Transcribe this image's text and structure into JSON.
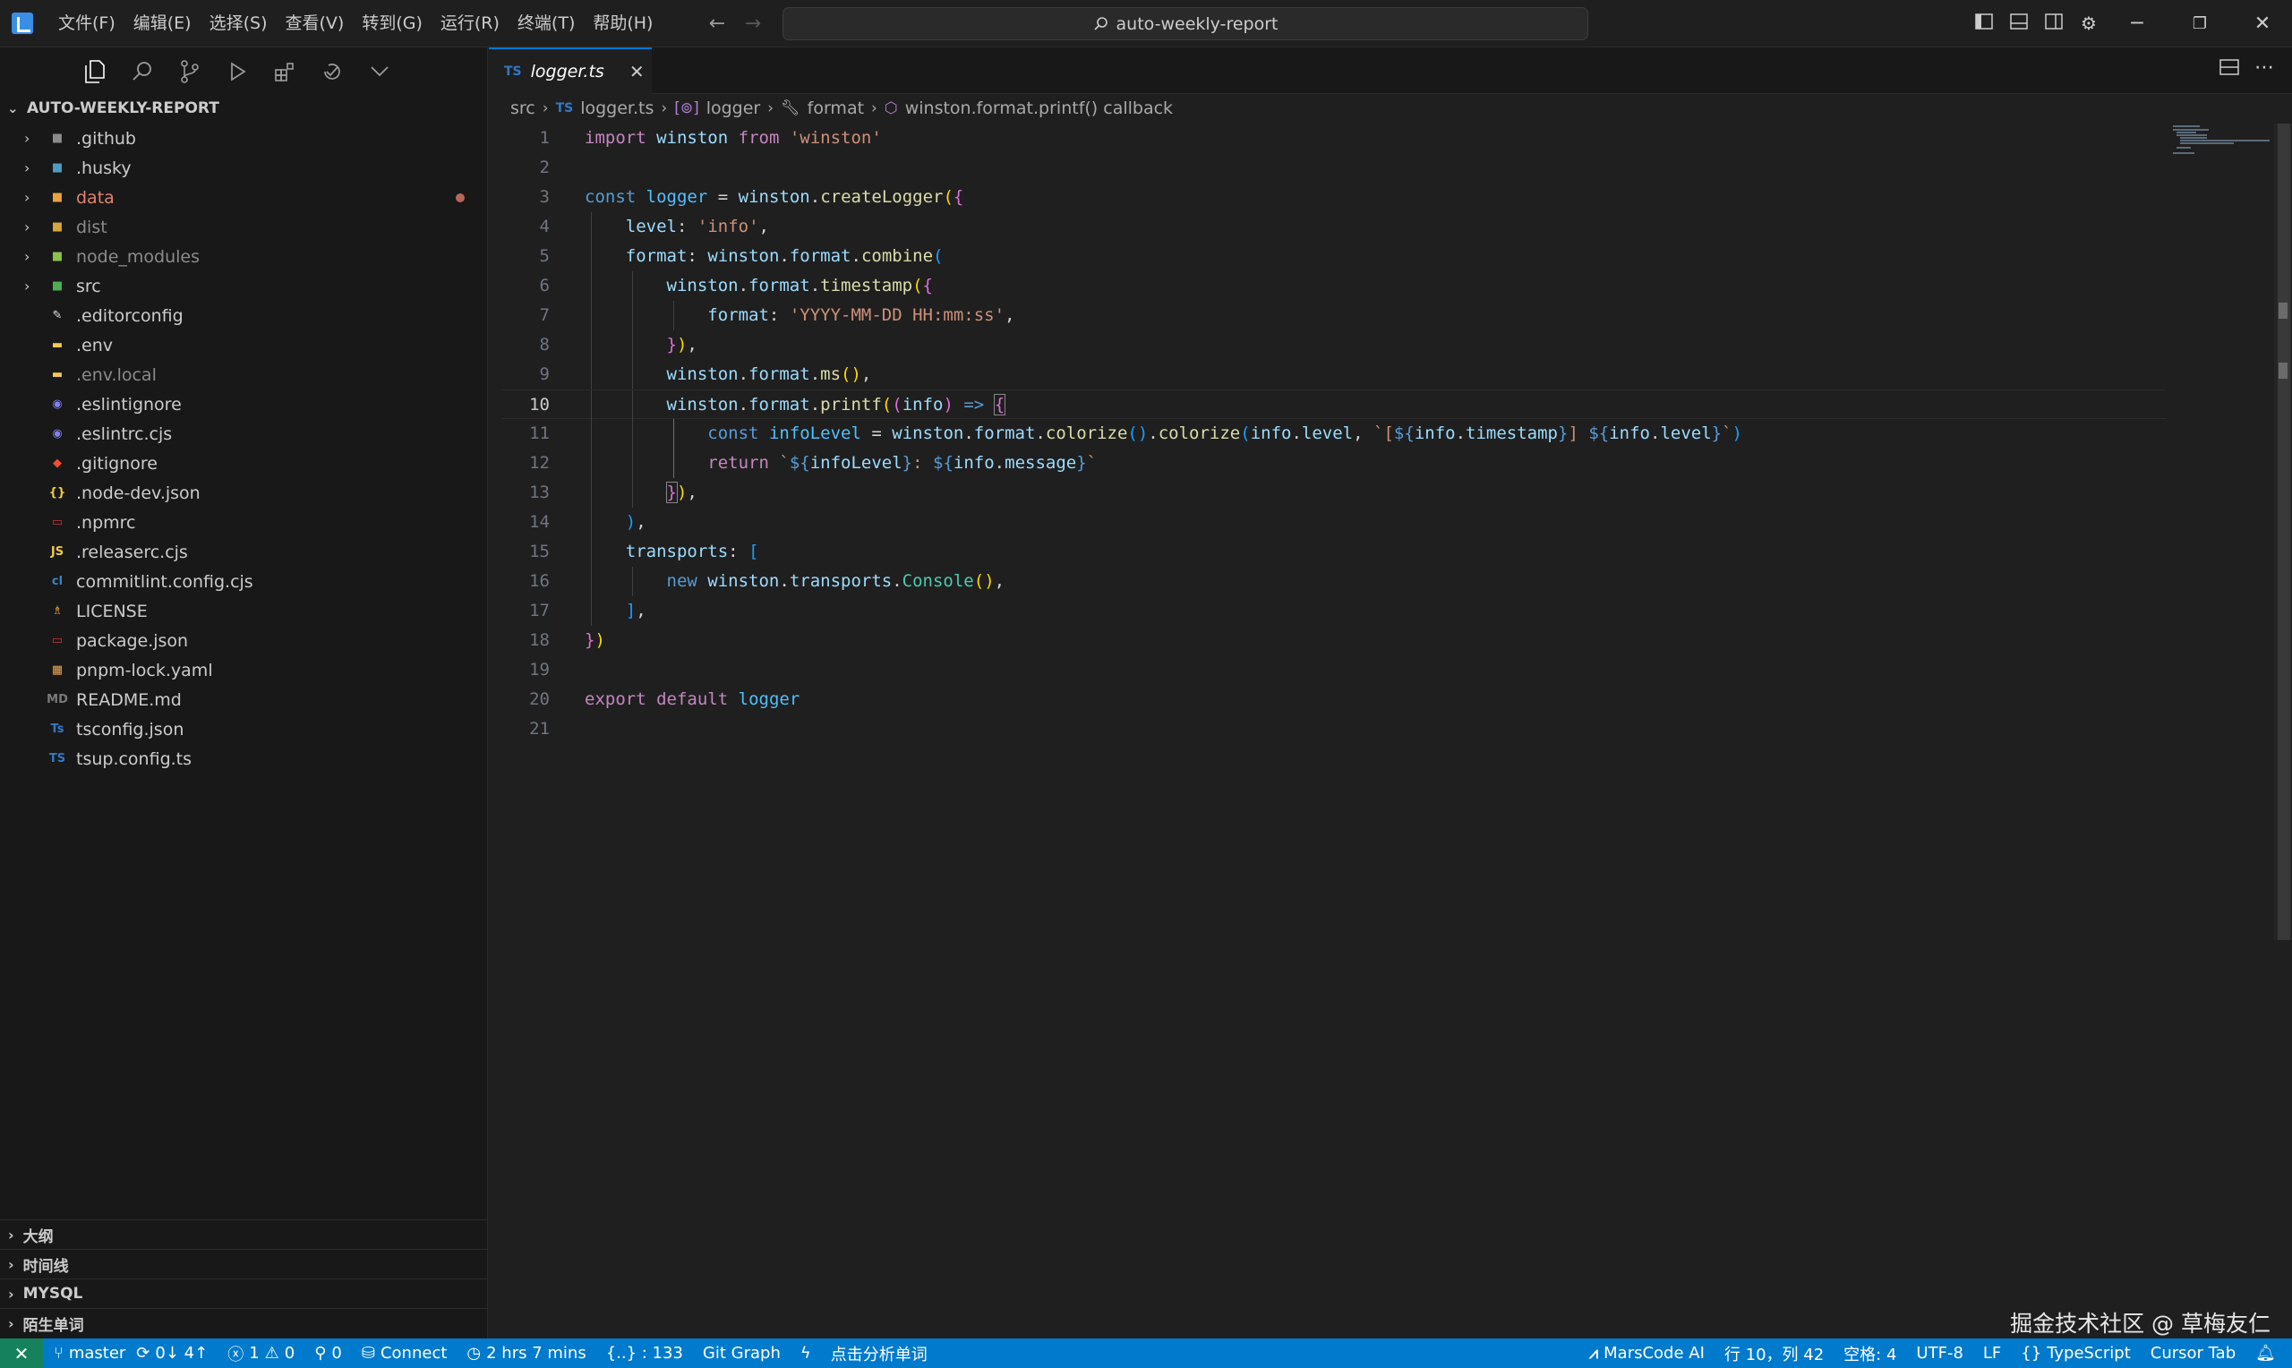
{
  "titlebar": {
    "menus": [
      "文件(F)",
      "编辑(E)",
      "选择(S)",
      "查看(V)",
      "转到(G)",
      "运行(R)",
      "终端(T)",
      "帮助(H)"
    ],
    "search_text": "auto-weekly-report"
  },
  "explorer": {
    "title": "AUTO-WEEKLY-REPORT",
    "items": [
      {
        "name": ".github",
        "folder": true,
        "icon": "github-folder-icon",
        "color": "#cccccc"
      },
      {
        "name": ".husky",
        "folder": true,
        "icon": "husky-folder-icon",
        "color": "#cccccc"
      },
      {
        "name": "data",
        "folder": true,
        "icon": "data-folder-icon",
        "color": "#e2836c",
        "modified": true
      },
      {
        "name": "dist",
        "folder": true,
        "icon": "dist-folder-icon",
        "color": "#8b8b8b"
      },
      {
        "name": "node_modules",
        "folder": true,
        "icon": "node-folder-icon",
        "color": "#8b8b8b"
      },
      {
        "name": "src",
        "folder": true,
        "icon": "src-folder-icon",
        "color": "#cccccc"
      },
      {
        "name": ".editorconfig",
        "folder": false,
        "icon": "editorconfig-icon",
        "color": "#cccccc"
      },
      {
        "name": ".env",
        "folder": false,
        "icon": "env-icon",
        "color": "#cccccc"
      },
      {
        "name": ".env.local",
        "folder": false,
        "icon": "env-icon",
        "color": "#8b8b8b"
      },
      {
        "name": ".eslintignore",
        "folder": false,
        "icon": "eslint-icon",
        "color": "#cccccc"
      },
      {
        "name": ".eslintrc.cjs",
        "folder": false,
        "icon": "eslint-icon",
        "color": "#cccccc"
      },
      {
        "name": ".gitignore",
        "folder": false,
        "icon": "git-icon",
        "color": "#cccccc"
      },
      {
        "name": ".node-dev.json",
        "folder": false,
        "icon": "json-icon",
        "color": "#cccccc"
      },
      {
        "name": ".npmrc",
        "folder": false,
        "icon": "npm-icon",
        "color": "#cccccc"
      },
      {
        "name": ".releaserc.cjs",
        "folder": false,
        "icon": "js-icon",
        "color": "#cccccc"
      },
      {
        "name": "commitlint.config.cjs",
        "folder": false,
        "icon": "commitlint-icon",
        "color": "#cccccc"
      },
      {
        "name": "LICENSE",
        "folder": false,
        "icon": "license-icon",
        "color": "#cccccc"
      },
      {
        "name": "package.json",
        "folder": false,
        "icon": "npm-icon",
        "color": "#cccccc"
      },
      {
        "name": "pnpm-lock.yaml",
        "folder": false,
        "icon": "pnpm-icon",
        "color": "#cccccc"
      },
      {
        "name": "README.md",
        "folder": false,
        "icon": "readme-icon",
        "color": "#cccccc"
      },
      {
        "name": "tsconfig.json",
        "folder": false,
        "icon": "tsconfig-icon",
        "color": "#cccccc"
      },
      {
        "name": "tsup.config.ts",
        "folder": false,
        "icon": "ts-icon",
        "color": "#cccccc"
      }
    ]
  },
  "panels": [
    "大纲",
    "时间线",
    "MYSQL",
    "陌生单词"
  ],
  "editor": {
    "tab": {
      "lang": "TS",
      "name": "logger.ts"
    },
    "breadcrumb": {
      "folder": "src",
      "lang": "TS",
      "file": "logger.ts",
      "symbol1": "logger",
      "symbol2": "format",
      "symbol3": "winston.format.printf() callback"
    },
    "current_line": 10
  },
  "watermark": "掘金技术社区 @ 草梅友仁",
  "statusbar": {
    "branch": "master",
    "sync": "0↓ 4↑",
    "errors": "1",
    "warnings": "0",
    "ports": "0",
    "connect": "Connect",
    "time": "2 hrs 7 mins",
    "braces": "{..} : 133",
    "git_graph": "Git Graph",
    "analyze": "点击分析单词",
    "marscode": "MarsCode AI",
    "position": "行 10，列 42",
    "spaces": "空格: 4",
    "encoding": "UTF-8",
    "eol": "LF",
    "language": "TypeScript",
    "cursor_tab": "Cursor Tab"
  }
}
